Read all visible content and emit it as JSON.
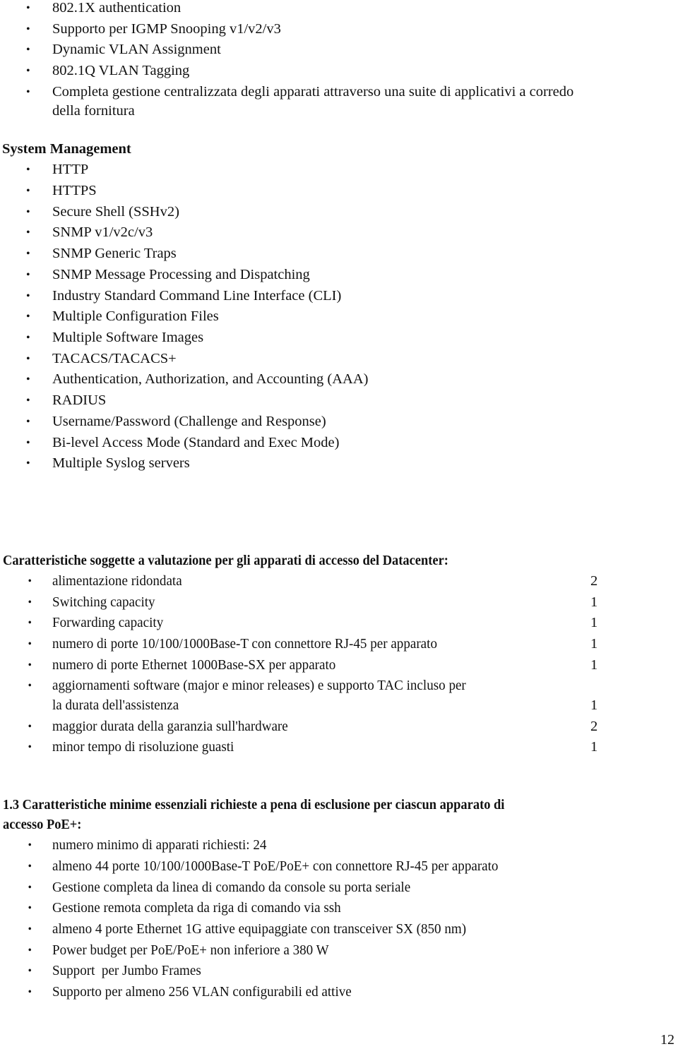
{
  "top_list": [
    "802.1X authentication",
    "Supporto per IGMP Snooping v1/v2/v3",
    "Dynamic VLAN Assignment",
    "802.1Q VLAN Tagging",
    "Completa gestione centralizzata degli apparati attraverso una suite di applicativi a corredo",
    "della fornitura"
  ],
  "system_management": {
    "heading": "System Management",
    "items": [
      "HTTP",
      "HTTPS",
      "Secure Shell (SSHv2)",
      "SNMP v1/v2c/v3",
      "SNMP Generic Traps",
      "SNMP Message Processing and Dispatching",
      "Industry Standard Command Line Interface (CLI)",
      "Multiple Configuration Files",
      "Multiple Software Images",
      "TACACS/TACACS+",
      "Authentication, Authorization, and Accounting (AAA)",
      "RADIUS",
      "Username/Password (Challenge and Response)",
      "Bi-level Access Mode (Standard and Exec Mode)",
      "Multiple Syslog servers"
    ]
  },
  "evaluation": {
    "heading": "Caratteristiche soggette a valutazione per gli apparati di accesso del Datacenter:",
    "items": [
      {
        "label": "alimentazione ridondata",
        "score": "2"
      },
      {
        "label": "Switching capacity",
        "score": "1"
      },
      {
        "label": "Forwarding capacity",
        "score": "1"
      },
      {
        "label": "numero di porte 10/100/1000Base-T con connettore RJ-45 per apparato",
        "score": "1"
      },
      {
        "label": "numero di porte Ethernet 1000Base-SX per apparato",
        "score": "1"
      },
      {
        "label": "aggiornamenti software (major e minor releases) e supporto TAC incluso per",
        "label_cont": "la durata dell'assistenza",
        "score": "1"
      },
      {
        "label": "maggior durata della garanzia sull'hardware",
        "score": "2"
      },
      {
        "label": "minor tempo di risoluzione guasti",
        "score": "1"
      }
    ]
  },
  "section_1_3": {
    "heading_line1": "1.3 Caratteristiche minime essenziali richieste a pena di esclusione per ciascun apparato di",
    "heading_line2": "accesso PoE+:",
    "items": [
      "numero minimo di apparati richiesti: 24",
      "almeno 44 porte 10/100/1000Base-T PoE/PoE+ con connettore RJ-45 per apparato",
      "Gestione completa da linea di comando da console su porta seriale",
      "Gestione remota completa da riga di comando via ssh",
      "almeno 4 porte Ethernet 1G attive equipaggiate con transceiver SX (850 nm)",
      "Power budget per PoE/PoE+ non inferiore a 380 W",
      "Support  per Jumbo Frames",
      "Supporto per almeno 256 VLAN configurabili ed attive"
    ]
  },
  "bullet_glyph": "•",
  "page_number": "12"
}
